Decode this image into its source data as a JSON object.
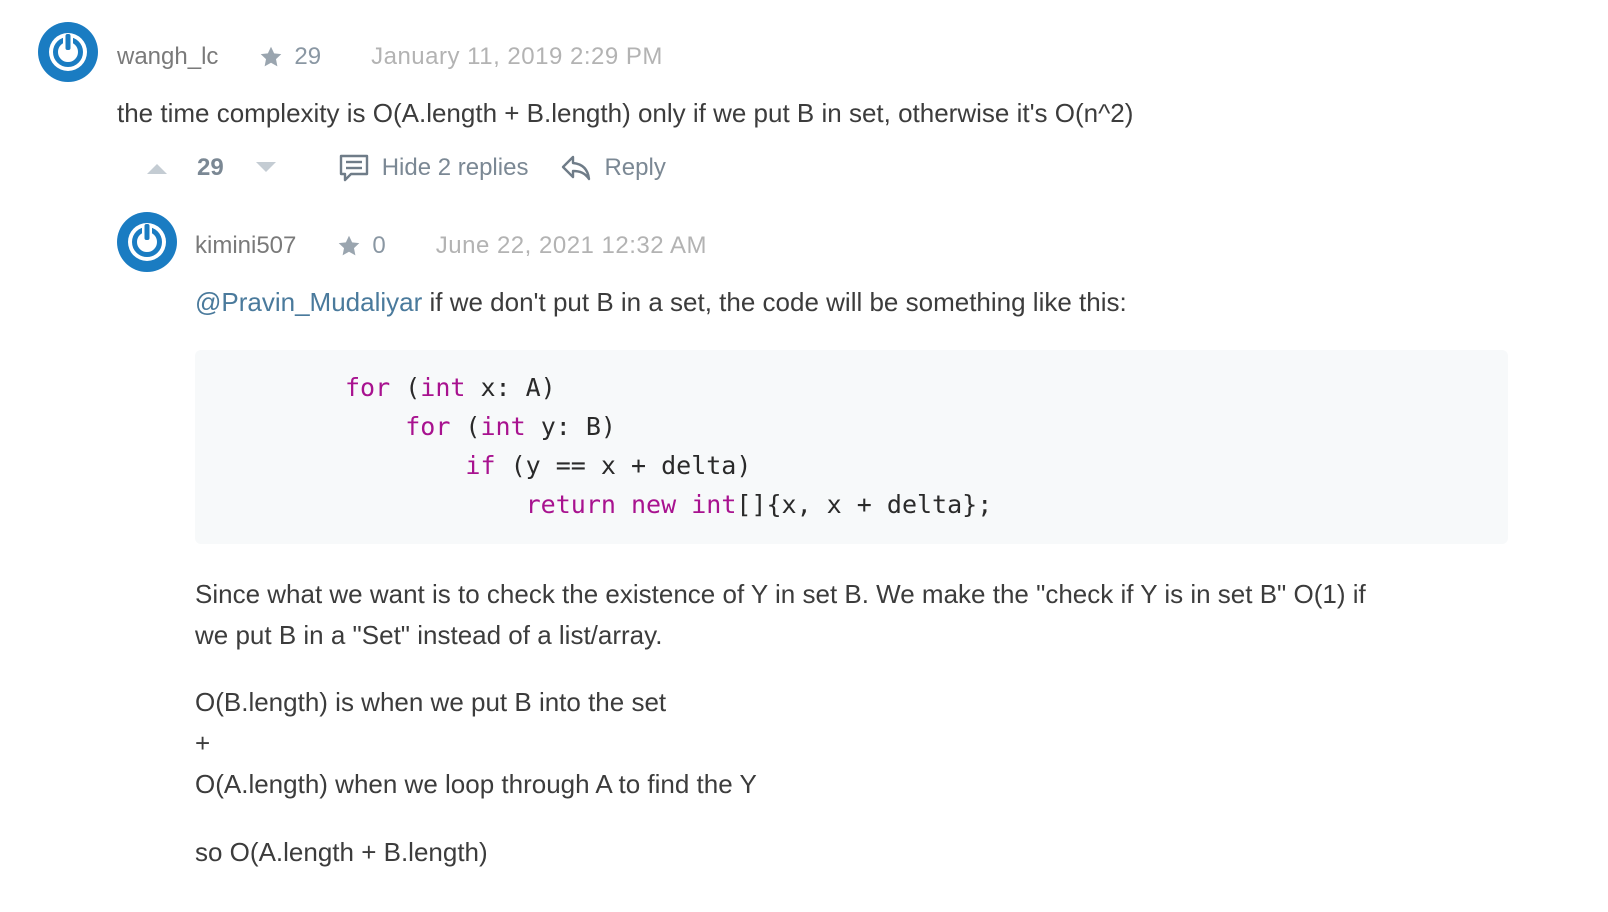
{
  "comment": {
    "username": "wangh_lc",
    "reputation": "29",
    "date": "January 11, 2019 2:29 PM",
    "text": "the time complexity is O(A.length + B.length) only if we put B in set, otherwise it's O(n^2)",
    "votes": "29",
    "hide_replies_label": "Hide 2 replies",
    "reply_label": "Reply"
  },
  "reply": {
    "username": "kimini507",
    "reputation": "0",
    "date": "June 22, 2021 12:32 AM",
    "mention": "@Pravin_Mudaliyar",
    "intro_text": " if we don't put B in a set, the code will be something like this:",
    "code": {
      "line1_kw1": "for",
      "line1_pre": " (",
      "line1_kw2": "int",
      "line1_rest": " x: A)",
      "line2_kw1": "for",
      "line2_pre": " (",
      "line2_kw2": "int",
      "line2_rest": " y: B)",
      "line3_kw1": "if",
      "line3_rest": " (y == x + delta)",
      "line4_kw1": "return",
      "line4_kw2": "new",
      "line4_kw3": "int",
      "line4_rest": "[]{x, x + delta};"
    },
    "para1_line1": "Since what we want is to check the existence of Y in set B. We make the \"check if Y is in set B\" O(1) if",
    "para1_line2": "we put B in a \"Set\" instead of a list/array.",
    "para2_line1": "O(B.length) is when we put B into the set",
    "para2_line2": "+",
    "para2_line3": "O(A.length) when we loop through A to find the Y",
    "para3": "so O(A.length + B.length)"
  },
  "icons": {
    "avatar": "power-avatar-icon",
    "star": "star-icon",
    "upvote": "upvote-arrow-icon",
    "downvote": "downvote-arrow-icon",
    "comment": "comment-icon",
    "reply": "reply-arrow-icon"
  },
  "colors": {
    "avatar_blue": "#1a7cc2",
    "keyword": "#a8128f",
    "mention": "#4a7a9c",
    "code_bg": "#f7f9fa"
  }
}
